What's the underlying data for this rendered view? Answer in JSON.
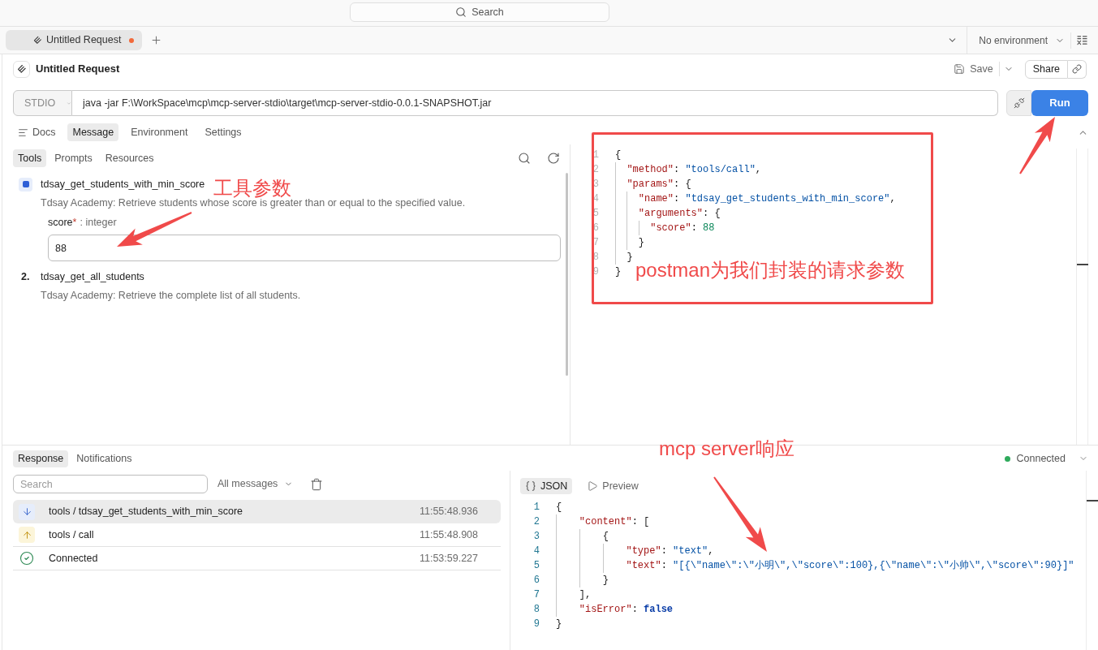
{
  "search_bar": {
    "label": "Search"
  },
  "tabs": [
    {
      "label": "Untitled Request",
      "selected": true,
      "unsaved": true
    }
  ],
  "environment": {
    "label": "No environment"
  },
  "request": {
    "title": "Untitled Request",
    "save": "Save",
    "share": "Share",
    "transport": "STDIO",
    "command": "java -jar F:\\WorkSpace\\mcp\\mcp-server-stdio\\target\\mcp-server-stdio-0.0.1-SNAPSHOT.jar",
    "run": "Run"
  },
  "request_tabs": [
    {
      "label": "Docs",
      "kind": "docs",
      "selected": false
    },
    {
      "label": "Message",
      "kind": "plain",
      "selected": true
    },
    {
      "label": "Environment",
      "kind": "plain",
      "selected": false
    },
    {
      "label": "Settings",
      "kind": "plain",
      "selected": false
    }
  ],
  "message_tabs": [
    {
      "label": "Tools",
      "selected": true
    },
    {
      "label": "Prompts",
      "selected": false
    },
    {
      "label": "Resources",
      "selected": false
    }
  ],
  "tools": [
    {
      "name": "tdsay_get_students_with_min_score",
      "description": "Tdsay Academy: Retrieve students whose score is greater than or equal to the specified value.",
      "selected": true,
      "params": [
        {
          "name": "score",
          "required_mark": "*",
          "type": ": integer",
          "value": "88"
        }
      ]
    },
    {
      "number": "2.",
      "name": "tdsay_get_all_students",
      "description": "Tdsay Academy: Retrieve the complete list of all students.",
      "selected": false
    }
  ],
  "request_body": {
    "lines": [
      {
        "number": "1",
        "text": "{"
      },
      {
        "number": "2",
        "text": "  \"method\": \"tools/call\","
      },
      {
        "number": "3",
        "text": "  \"params\": {"
      },
      {
        "number": "4",
        "text": "    \"name\": \"tdsay_get_students_with_min_score\","
      },
      {
        "number": "5",
        "text": "    \"arguments\": {"
      },
      {
        "number": "6",
        "text": "      \"score\": 88"
      },
      {
        "number": "7",
        "text": "    }"
      },
      {
        "number": "8",
        "text": "  }"
      },
      {
        "number": "9",
        "text": "}"
      }
    ]
  },
  "response": {
    "tabs": [
      {
        "label": "Response",
        "selected": true
      },
      {
        "label": "Notifications",
        "selected": false
      }
    ],
    "status": {
      "label": "Connected",
      "connected": true
    },
    "search": {
      "placeholder": "Search"
    },
    "filter": "All messages",
    "messages": [
      {
        "kind": "incoming",
        "text": "tools / tdsay_get_students_with_min_score",
        "time": "11:55:48.936",
        "selected": true
      },
      {
        "kind": "outgoing",
        "text": "tools / call",
        "time": "11:55:48.908",
        "selected": false
      },
      {
        "kind": "status",
        "text": "Connected",
        "time": "11:53:59.227",
        "selected": false
      }
    ],
    "views": [
      {
        "label": "JSON",
        "kind": "json",
        "selected": true
      },
      {
        "label": "Preview",
        "kind": "preview",
        "selected": false
      }
    ],
    "body": {
      "lines": [
        {
          "number": "1",
          "text": "{"
        },
        {
          "number": "2",
          "text": "    \"content\": ["
        },
        {
          "number": "3",
          "text": "        {"
        },
        {
          "number": "4",
          "text": "            \"type\": \"text\","
        },
        {
          "number": "5",
          "text": "            \"text\": \"[{\\\"name\\\":\\\"小明\\\",\\\"score\\\":100},{\\\"name\\\":\\\"小帅\\\",\\\"score\\\":90}]\""
        },
        {
          "number": "6",
          "text": "        }"
        },
        {
          "number": "7",
          "text": "    ],"
        },
        {
          "number": "8",
          "text": "    \"isError\": false"
        },
        {
          "number": "9",
          "text": "}"
        }
      ]
    }
  },
  "annotations": [
    {
      "text": "工具参数"
    },
    {
      "text": "postman为我们封装的请求参数"
    },
    {
      "text": "mcp server响应"
    }
  ]
}
